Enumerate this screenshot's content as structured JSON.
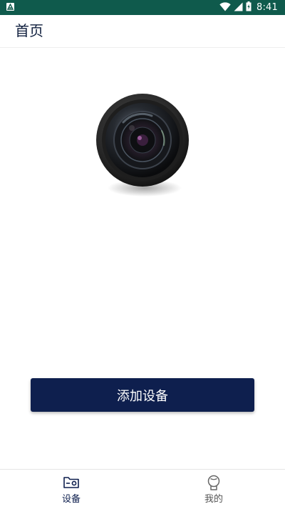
{
  "status_bar": {
    "time": "8:41",
    "background": "#0f5a4c",
    "icons": [
      "app-notification-icon",
      "wifi-icon",
      "signal-icon",
      "battery-icon"
    ]
  },
  "header": {
    "title": "首页"
  },
  "hero": {
    "image": "camera-lens-illustration"
  },
  "main": {
    "add_device_label": "添加设备",
    "button_color": "#0e1f4e"
  },
  "bottom_nav": {
    "items": [
      {
        "label": "设备",
        "icon": "camera-device-icon",
        "active": true
      },
      {
        "label": "我的",
        "icon": "profile-icon",
        "active": false
      }
    ],
    "active_color": "#0e1f4e",
    "inactive_color": "#555555"
  }
}
